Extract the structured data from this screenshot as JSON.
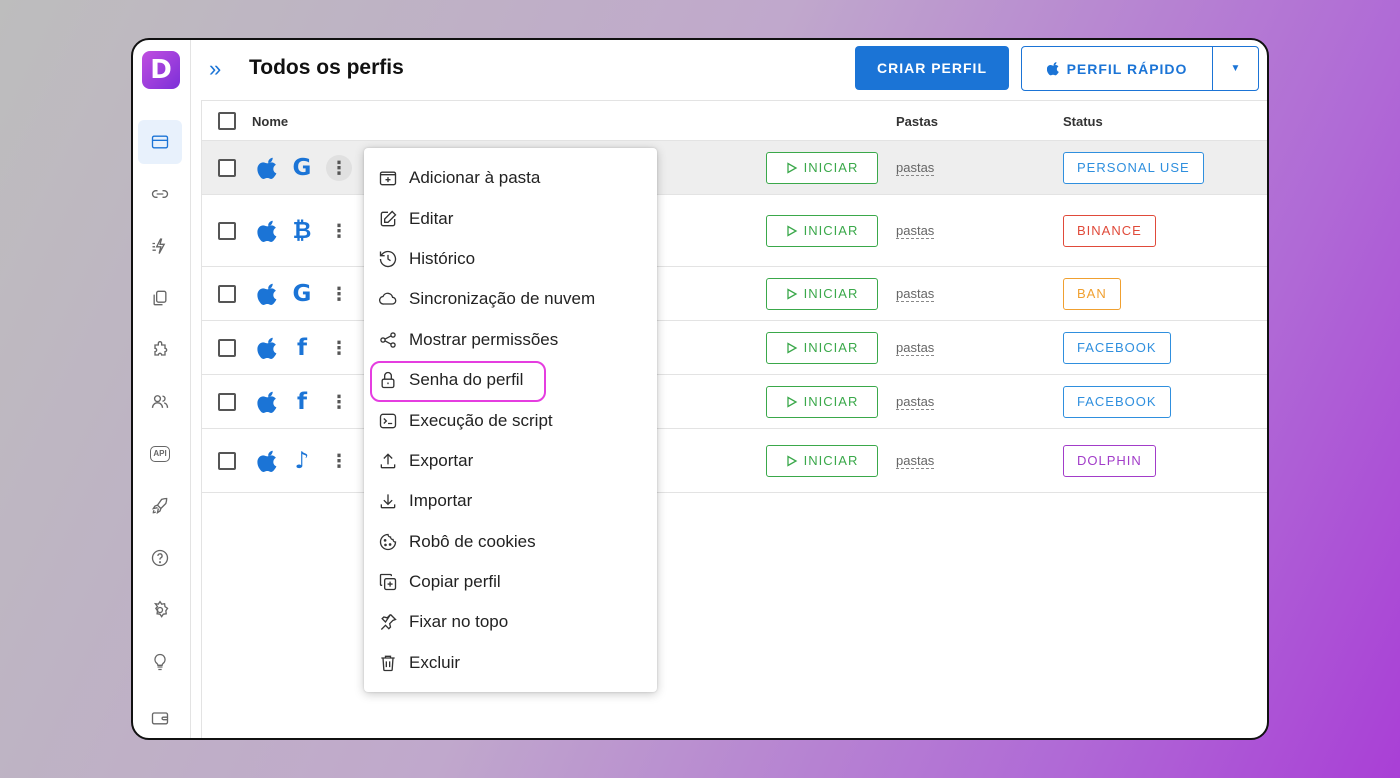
{
  "header": {
    "title": "Todos os perfis",
    "create_label": "CRIAR PERFIL",
    "quick_label": "PERFIL RÁPIDO"
  },
  "table": {
    "columns": {
      "name": "Nome",
      "folders": "Pastas",
      "status": "Status"
    },
    "start_label": "INICIAR",
    "folders_link": "pastas",
    "rows": [
      {
        "service_icon": "google-icon",
        "service_glyph": "G",
        "status": "PERSONAL USE",
        "status_color": "#2f8fde"
      },
      {
        "service_icon": "bitcoin-icon",
        "service_glyph": "₿",
        "status": "BINANCE",
        "status_color": "#e04a3a"
      },
      {
        "service_icon": "google-icon",
        "service_glyph": "G",
        "status": "BAN",
        "status_color": "#f0a030"
      },
      {
        "service_icon": "facebook-icon",
        "service_glyph": "f",
        "status": "FACEBOOK",
        "status_color": "#2f8fde"
      },
      {
        "service_icon": "facebook-icon",
        "service_glyph": "f",
        "status": "FACEBOOK",
        "status_color": "#2f8fde"
      },
      {
        "service_icon": "tiktok-icon",
        "service_glyph": "♪",
        "status": "DOLPHIN",
        "status_color": "#a23cc9"
      }
    ]
  },
  "menu": {
    "items": [
      {
        "label": "Adicionar à pasta",
        "icon": "folder-plus-icon"
      },
      {
        "label": "Editar",
        "icon": "edit-icon"
      },
      {
        "label": "Histórico",
        "icon": "history-icon"
      },
      {
        "label": "Sincronização de nuvem",
        "icon": "cloud-icon"
      },
      {
        "label": "Mostrar permissões",
        "icon": "share-icon"
      },
      {
        "label": "Senha do perfil",
        "icon": "lock-icon"
      },
      {
        "label": "Execução de script",
        "icon": "terminal-icon"
      },
      {
        "label": "Exportar",
        "icon": "upload-icon"
      },
      {
        "label": "Importar",
        "icon": "download-icon"
      },
      {
        "label": "Robô de cookies",
        "icon": "cookie-icon"
      },
      {
        "label": "Copiar perfil",
        "icon": "copy-icon"
      },
      {
        "label": "Fixar no topo",
        "icon": "pin-icon"
      },
      {
        "label": "Excluir",
        "icon": "trash-icon"
      }
    ]
  },
  "sidebar": {
    "logo_letter": "D",
    "api_label": "API",
    "icons": [
      "browser-icon",
      "link-icon",
      "automation-icon",
      "copy-icon",
      "extensions-icon",
      "users-icon",
      "api-icon",
      "rocket-icon",
      "help-icon",
      "settings-icon",
      "lightbulb-icon",
      "wallet-icon"
    ]
  }
}
